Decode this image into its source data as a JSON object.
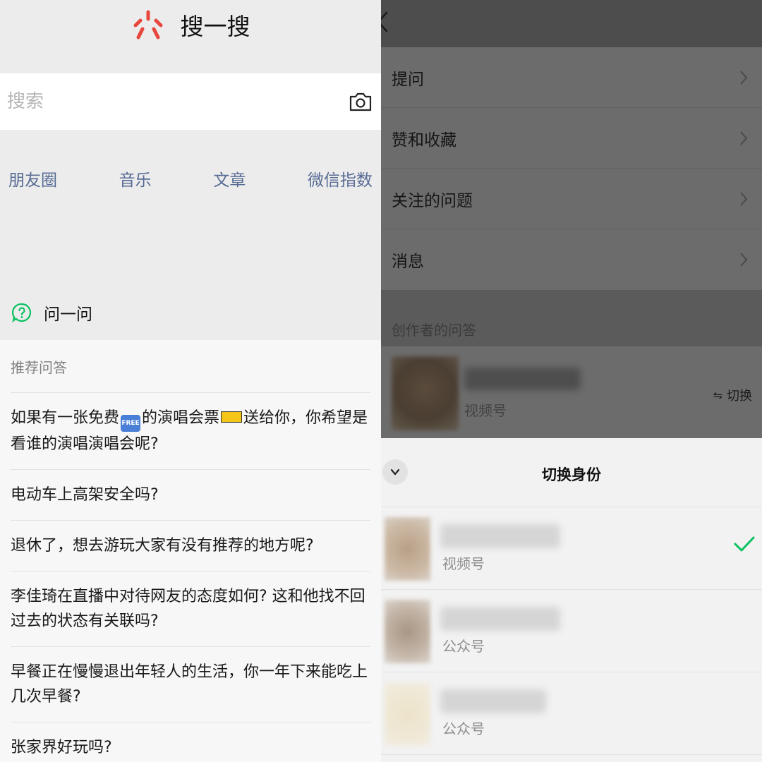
{
  "left": {
    "header": {
      "title": "搜一搜"
    },
    "search": {
      "placeholder": "搜索"
    },
    "quick_links": [
      "朋友圈",
      "音乐",
      "文章",
      "微信指数"
    ],
    "ask": {
      "title": "问一问"
    },
    "qa": {
      "header": "推荐问答",
      "items": [
        {
          "before": "如果有一张免费",
          "free_emoji": "FREE",
          "middle": "的演唱会票",
          "after": "送给你，你希望是看谁的演唱演唱会呢?"
        },
        {
          "text": "电动车上高架安全吗?"
        },
        {
          "text": "退休了，想去游玩大家有没有推荐的地方呢?"
        },
        {
          "text": "李佳琦在直播中对待网友的态度如何? 这和他找不回过去的状态有关联吗?"
        },
        {
          "text": "早餐正在慢慢退出年轻人的生活，你一年下来能吃上几次早餐?"
        },
        {
          "text": "张家界好玩吗?"
        }
      ]
    }
  },
  "right": {
    "menu": [
      {
        "label": "提问"
      },
      {
        "label": "赞和收藏"
      },
      {
        "label": "关注的问题"
      },
      {
        "label": "消息"
      }
    ],
    "section_label": "创作者的问答",
    "creator": {
      "type": "视频号",
      "switch_label": "切换",
      "switch_icon": "⇋"
    },
    "sheet": {
      "title": "切换身份",
      "identities": [
        {
          "type": "视频号",
          "selected": true
        },
        {
          "type": "公众号",
          "selected": false
        },
        {
          "type": "公众号",
          "selected": false
        }
      ]
    }
  },
  "colors": {
    "link": "#576b95",
    "check": "#07c160",
    "logo": "#e8473d"
  }
}
